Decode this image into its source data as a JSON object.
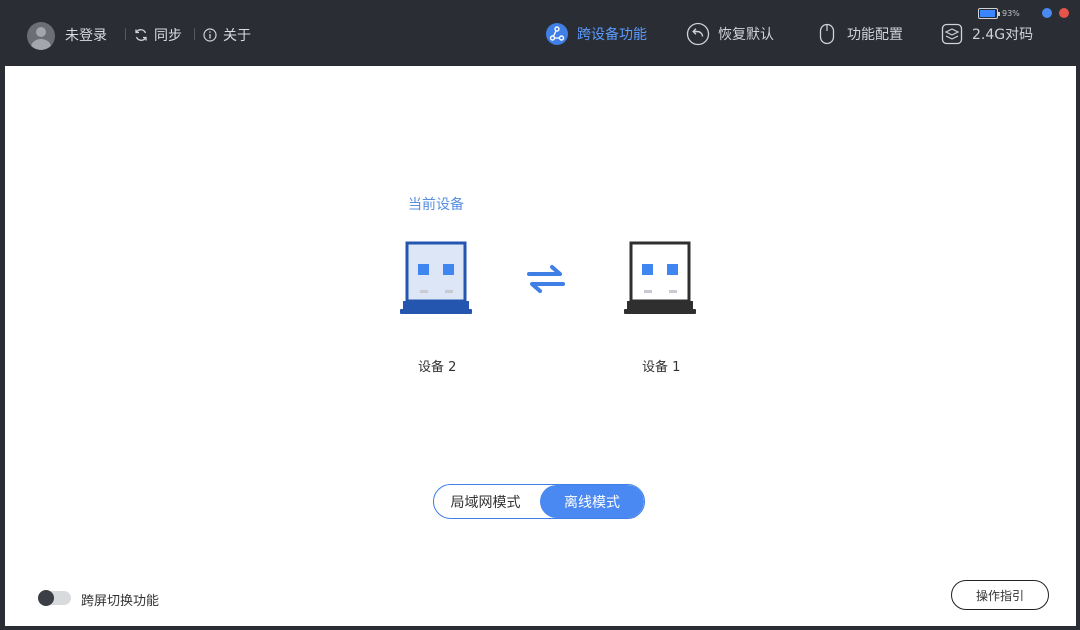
{
  "header": {
    "login_label": "未登录",
    "sync_label": "同步",
    "about_label": "关于",
    "nav": [
      {
        "label": "跨设备功能",
        "icon": "share-network-icon",
        "active": true
      },
      {
        "label": "恢复默认",
        "icon": "restore-icon",
        "active": false
      },
      {
        "label": "功能配置",
        "icon": "mouse-icon",
        "active": false
      },
      {
        "label": "2.4G对码",
        "icon": "layers-icon",
        "active": false
      }
    ],
    "battery_percent": "93%",
    "battery_level": 0.93,
    "window_dots": {
      "blue": "#4a88f2",
      "red": "#e5534b"
    }
  },
  "main": {
    "current_device_label": "当前设备",
    "devices": [
      {
        "label": "设备 2",
        "current": true,
        "color": "#2456b0"
      },
      {
        "label": "设备 1",
        "current": false,
        "color": "#2f2f2f"
      }
    ],
    "modes": [
      {
        "label": "局域网模式",
        "selected": false
      },
      {
        "label": "离线模式",
        "selected": true
      }
    ],
    "cross_screen_label": "跨屏切换功能",
    "cross_screen_enabled": false,
    "guide_label": "操作指引"
  },
  "colors": {
    "accent": "#4a88f2",
    "accent_text": "#5b9cff"
  }
}
